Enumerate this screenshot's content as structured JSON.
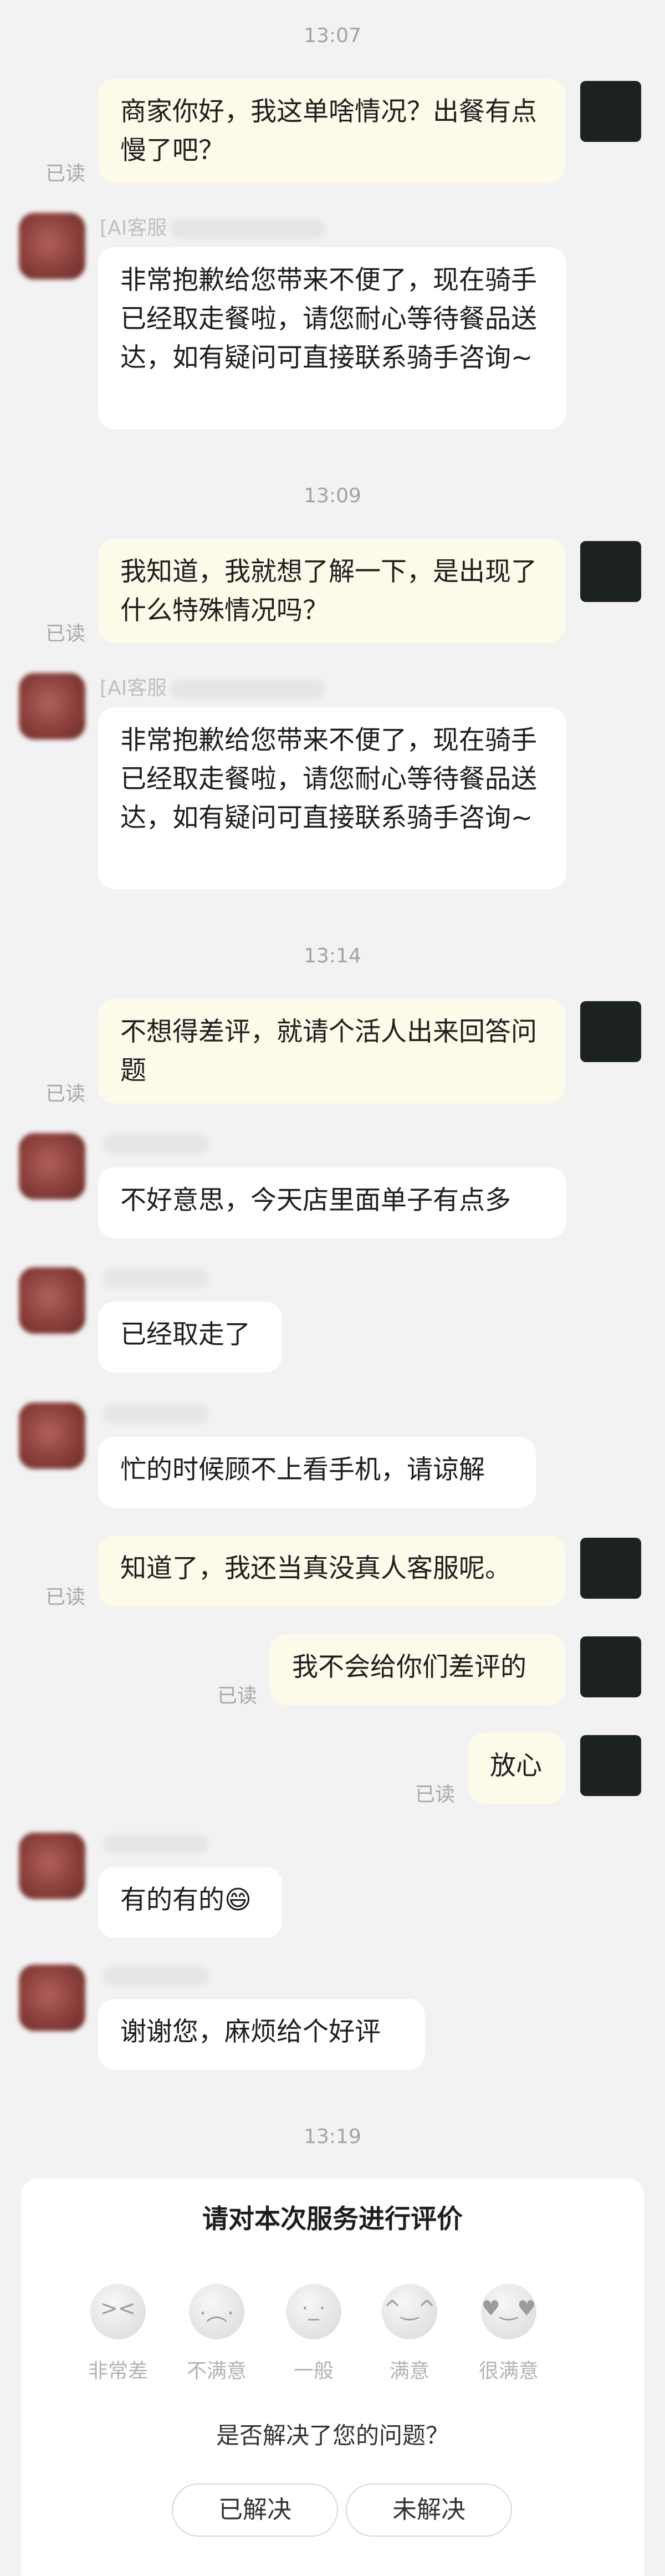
{
  "times": [
    "13:07",
    "13:09",
    "13:14",
    "13:19"
  ],
  "read_label": "已读",
  "agent_name_prefix": "[AI客服",
  "messages": {
    "m1": "商家你好，我这单啥情况？出餐有点慢了吧？",
    "m2": "非常抱歉给您带来不便了，现在骑手已经取走餐啦，请您耐心等待餐品送达，如有疑问可直接联系骑手咨询~",
    "m3": "我知道，我就想了解一下，是出现了什么特殊情况吗？",
    "m4": "非常抱歉给您带来不便了，现在骑手已经取走餐啦，请您耐心等待餐品送达，如有疑问可直接联系骑手咨询~",
    "m5": "不想得差评，就请个活人出来回答问题",
    "m6": "不好意思，今天店里面单子有点多",
    "m7": "已经取走了",
    "m8": "忙的时候顾不上看手机，请谅解",
    "m9": "知道了，我还当真没真人客服呢。",
    "m10": "我不会给你们差评的",
    "m11": "放心",
    "m12": "有的有的😄",
    "m13": "谢谢您，麻烦给个好评"
  },
  "rating": {
    "title": "请对本次服务进行评价",
    "options": [
      "非常差",
      "不满意",
      "一般",
      "满意",
      "很满意"
    ],
    "question": "是否解决了您的问题？",
    "resolved": "已解决",
    "unresolved": "未解决"
  }
}
